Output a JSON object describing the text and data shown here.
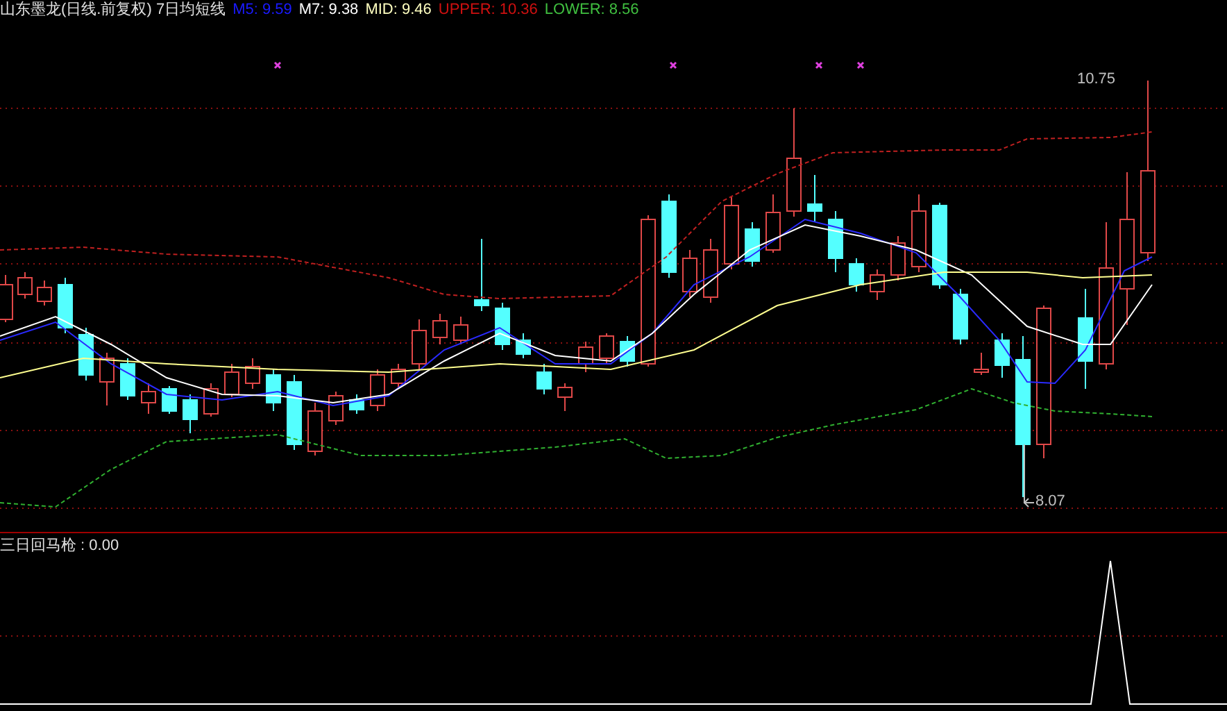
{
  "main_panel": {
    "title": "山东墨龙(日线.前复权) 7日均短线",
    "indicators": [
      {
        "label": "M5: 9.59",
        "color": "#1a1aff"
      },
      {
        "label": "M7: 9.38",
        "color": "#ffffff"
      },
      {
        "label": "MID: 9.46",
        "color": "#ffffc0"
      },
      {
        "label": "UPPER: 10.36",
        "color": "#d01010"
      },
      {
        "label": "LOWER: 8.56",
        "color": "#40c040"
      }
    ],
    "high_label": "10.75",
    "low_label": "8.07"
  },
  "sub_panel": {
    "title": "三日回马枪 : 0.00"
  }
}
